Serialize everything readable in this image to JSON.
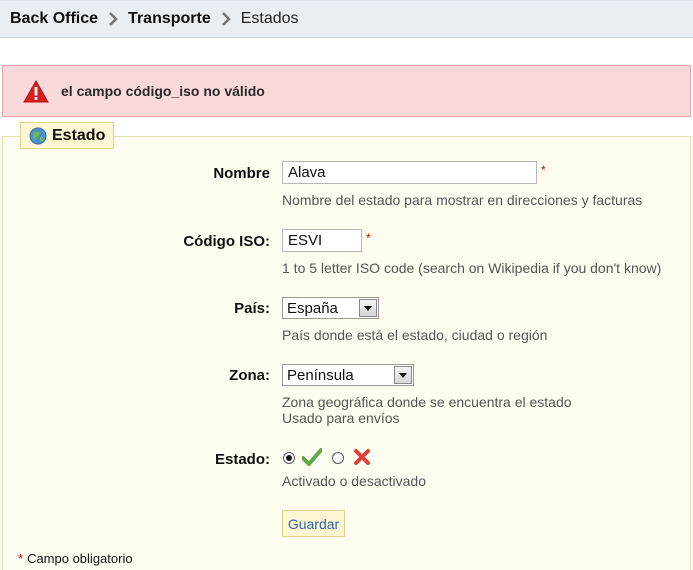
{
  "breadcrumb": {
    "items": [
      {
        "label": "Back Office"
      },
      {
        "label": "Transporte"
      },
      {
        "label": "Estados"
      }
    ]
  },
  "error": {
    "message": "el campo código_iso no válido",
    "icon": "warning-triangle-icon",
    "color": "#d9201f"
  },
  "panel": {
    "legend": "Estado",
    "legend_icon": "globe-icon"
  },
  "form": {
    "nombre": {
      "label": "Nombre",
      "value": "Alava",
      "required_mark": "*",
      "hint": "Nombre del estado para mostrar en direcciones y facturas"
    },
    "codigo_iso": {
      "label": "Código ISO:",
      "value": "ESVI",
      "required_mark": "*",
      "hint": "1 to 5 letter ISO code (search on Wikipedia if you don't know)"
    },
    "pais": {
      "label": "País:",
      "selected": "España",
      "hint": "País donde está el estado, ciudad o región"
    },
    "zona": {
      "label": "Zona:",
      "selected": "Península",
      "hint_line1": "Zona geográfica donde se encuentra el estado",
      "hint_line2": "Usado para envíos"
    },
    "estado": {
      "label": "Estado:",
      "active_selected": true,
      "hint": "Activado o desactivado",
      "enabled_icon": "check-icon",
      "disabled_icon": "cross-icon",
      "enabled_color": "#5aa84a",
      "disabled_color": "#e0403a"
    },
    "save_label": "Guardar"
  },
  "footnote": {
    "star": "*",
    "text": "Campo obligatorio"
  }
}
